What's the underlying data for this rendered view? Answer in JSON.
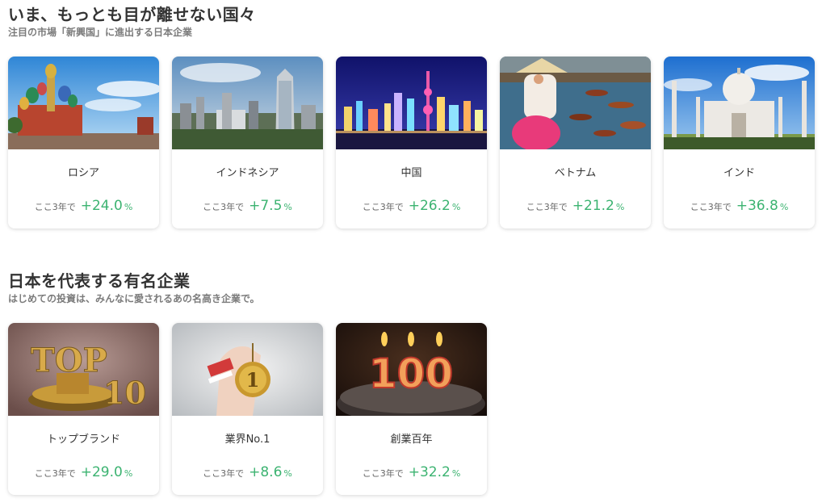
{
  "section_emerging": {
    "title": "いま、もっとも目が離せない国々",
    "subtitle": "注目の市場「新興国」に進出する日本企業",
    "cards": [
      {
        "name": "ロシア",
        "label": "ここ3年で",
        "value": "+24.0",
        "unit": "%",
        "image": "red-square-onion-domes"
      },
      {
        "name": "インドネシア",
        "label": "ここ3年で",
        "value": "+7.5",
        "unit": "%",
        "image": "jakarta-skyline"
      },
      {
        "name": "中国",
        "label": "ここ3年で",
        "value": "+26.2",
        "unit": "%",
        "image": "shanghai-night-skyline"
      },
      {
        "name": "ベトナム",
        "label": "ここ3年で",
        "value": "+21.2",
        "unit": "%",
        "image": "woman-conical-hat-boats"
      },
      {
        "name": "インド",
        "label": "ここ3年で",
        "value": "+36.8",
        "unit": "%",
        "image": "taj-mahal"
      }
    ]
  },
  "section_famous": {
    "title": "日本を代表する有名企業",
    "subtitle": "はじめての投資は、みんなに愛されるあの名高き企業で。",
    "cards": [
      {
        "name": "トップブランド",
        "label": "ここ3年で",
        "value": "+29.0",
        "unit": "%",
        "image": "top10-trophy",
        "img_text_top": "TOP",
        "img_text_10": "10"
      },
      {
        "name": "業界No.1",
        "label": "ここ3年で",
        "value": "+8.6",
        "unit": "%",
        "image": "gold-medal-hand",
        "img_text_medal": "1"
      },
      {
        "name": "創業百年",
        "label": "ここ3年で",
        "value": "+32.2",
        "unit": "%",
        "image": "100-candles-cake",
        "img_text_100": "100"
      }
    ]
  },
  "colors": {
    "accent_green": "#3cb371",
    "title_text": "#333333",
    "subtitle_text": "#7b7b7b"
  }
}
